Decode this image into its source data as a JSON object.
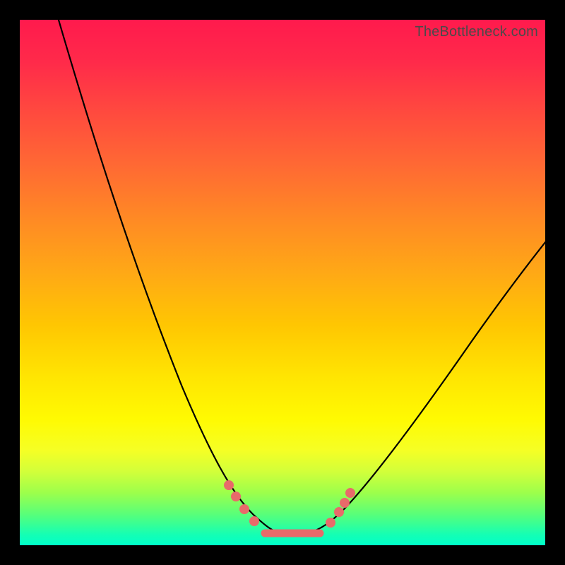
{
  "watermark": "TheBottleneck.com",
  "colors": {
    "frame": "#000000",
    "curve": "#000000",
    "markers": "#e86a6a"
  },
  "chart_data": {
    "type": "line",
    "title": "",
    "xlabel": "",
    "ylabel": "",
    "xlim": [
      0,
      100
    ],
    "ylim": [
      0,
      100
    ],
    "note": "Axes unlabeled; values are estimated normalized coordinates (0=left/bottom, 100=right/top).",
    "series": [
      {
        "name": "bottleneck-curve",
        "x": [
          0,
          5,
          10,
          15,
          20,
          25,
          30,
          35,
          38,
          40,
          43,
          46,
          48,
          52,
          55,
          58,
          62,
          66,
          70,
          76,
          84,
          92,
          100
        ],
        "y": [
          100,
          90,
          79,
          68,
          56,
          44,
          32,
          21,
          14,
          10,
          6,
          3,
          2,
          2,
          3,
          5,
          9,
          14,
          19,
          26,
          36,
          45,
          53
        ]
      }
    ],
    "markers": [
      {
        "x": 39,
        "y": 12
      },
      {
        "x": 41,
        "y": 9
      },
      {
        "x": 43,
        "y": 6
      },
      {
        "x": 45,
        "y": 4
      },
      {
        "x": 55,
        "y": 4
      },
      {
        "x": 57,
        "y": 6
      },
      {
        "x": 59,
        "y": 8
      },
      {
        "x": 61,
        "y": 11
      }
    ],
    "flat_segment": {
      "x_start": 46,
      "x_end": 54,
      "y": 2
    }
  }
}
